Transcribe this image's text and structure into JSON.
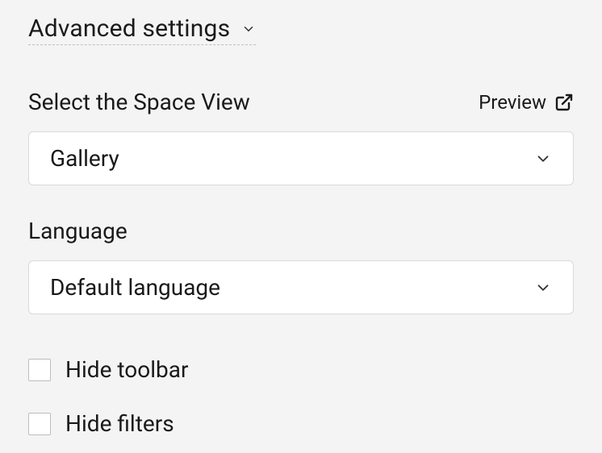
{
  "advanced": {
    "title": "Advanced settings"
  },
  "spaceView": {
    "label": "Select the Space View",
    "previewLabel": "Preview",
    "value": "Gallery"
  },
  "language": {
    "label": "Language",
    "value": "Default language"
  },
  "checkboxes": {
    "hideToolbar": "Hide toolbar",
    "hideFilters": "Hide filters"
  }
}
